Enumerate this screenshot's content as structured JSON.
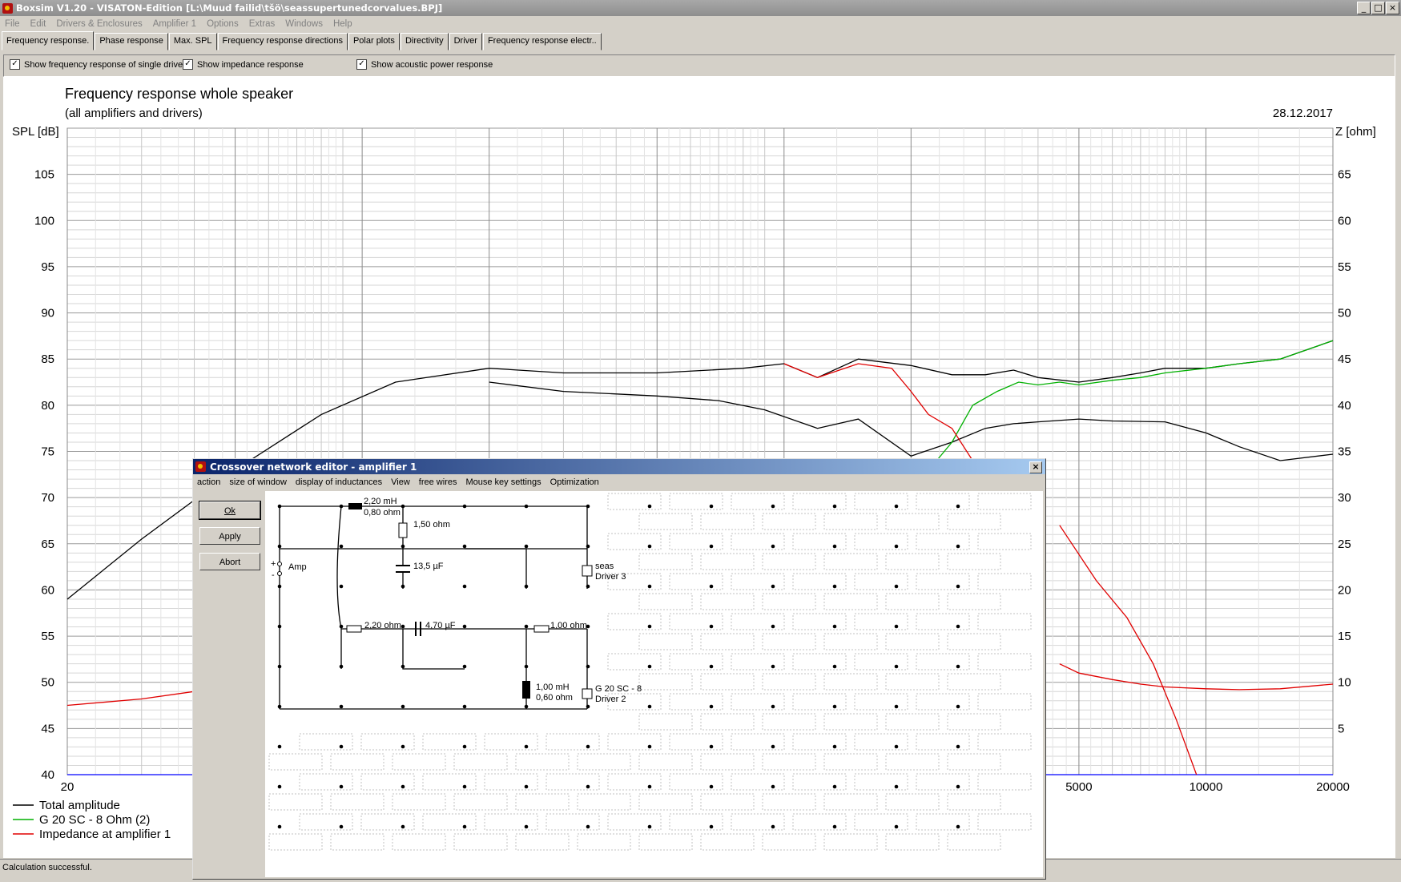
{
  "window": {
    "title": "Boxsim V1.20 - VISATON-Edition [L:\\Muud failid\\tšö\\seassupertunedcorvalues.BPJ]"
  },
  "menu": [
    "File",
    "Edit",
    "Drivers & Enclosures",
    "Amplifier 1",
    "Options",
    "Extras",
    "Windows",
    "Help"
  ],
  "tabs": [
    "Frequency response.",
    "Phase response",
    "Max. SPL",
    "Frequency response directions",
    "Polar plots",
    "Directivity",
    "Driver",
    "Frequency response electr.."
  ],
  "options": [
    {
      "label": "Show frequency response of single drive",
      "checked": true
    },
    {
      "label": "Show impedance response",
      "checked": true
    },
    {
      "label": "Show acoustic power response",
      "checked": true
    }
  ],
  "status": "Calculation successful.",
  "chart_data": {
    "type": "line",
    "title": "Frequency response whole speaker",
    "subtitle": "(all amplifiers and drivers)",
    "date": "28.12.2017",
    "ylabel": "SPL [dB]",
    "y2label": "Z [ohm]",
    "xscale": "log",
    "xlim": [
      20,
      20000
    ],
    "ylim": [
      40,
      110
    ],
    "y2lim": [
      0,
      70
    ],
    "xticks": [
      20,
      5000,
      10000,
      20000
    ],
    "yticks": [
      40,
      45,
      50,
      55,
      60,
      65,
      70,
      75,
      80,
      85,
      90,
      95,
      100,
      105
    ],
    "y2ticks": [
      5,
      10,
      15,
      20,
      25,
      30,
      35,
      40,
      45,
      50,
      55,
      60,
      65
    ],
    "legend_placement": "bottom-left",
    "series": [
      {
        "name": "Total amplitude",
        "color": "#000000",
        "x": [
          20,
          30,
          50,
          80,
          120,
          200,
          300,
          500,
          800,
          1000,
          1200,
          1500,
          2000,
          2500,
          3000,
          3500,
          4000,
          5000,
          6000,
          7000,
          8000,
          10000,
          12000,
          15000,
          20000
        ],
        "y": [
          59,
          65.5,
          73,
          79,
          82.5,
          84,
          83.5,
          83.5,
          84,
          84.5,
          83,
          85,
          84.3,
          83.3,
          83.3,
          83.8,
          83,
          82.5,
          83,
          83.5,
          84,
          84,
          84.5,
          85,
          87
        ]
      },
      {
        "name": "",
        "color": "#000000",
        "x": [
          200,
          300,
          500,
          700,
          900,
          1200,
          1500,
          2000,
          2500,
          3000,
          3500,
          4000,
          5000,
          6000,
          8000,
          10000,
          12000,
          15000,
          20000
        ],
        "y": [
          82.5,
          81.5,
          81,
          80.5,
          79.5,
          77.5,
          78.5,
          74.5,
          76,
          77.5,
          78,
          78.2,
          78.5,
          78.3,
          78.2,
          77,
          75.5,
          74,
          74.7
        ]
      },
      {
        "name": "G 20 SC - 8 Ohm (2)",
        "color": "#00b000",
        "x": [
          2300,
          2500,
          2800,
          3200,
          3600,
          4000,
          4500,
          5000,
          6000,
          7000,
          8000,
          10000,
          12000,
          15000,
          20000
        ],
        "y": [
          74,
          76,
          80,
          81.5,
          82.5,
          82.2,
          82.5,
          82.2,
          82.7,
          83,
          83.5,
          84,
          84.5,
          85,
          87
        ]
      },
      {
        "name": "",
        "color": "#e00000",
        "x": [
          1000,
          1200,
          1500,
          1800,
          2000,
          2200,
          2500,
          2800
        ],
        "y": [
          84.5,
          83,
          84.5,
          84,
          81.5,
          79,
          77.5,
          74
        ]
      },
      {
        "name": "Impedance at amplifier 1",
        "color": "#e00000",
        "x": [
          20,
          30,
          40,
          60
        ],
        "y": [
          7.5,
          8.2,
          9,
          11
        ]
      },
      {
        "name": "",
        "color": "#e00000",
        "x": [
          4500,
          5000,
          6000,
          7000,
          8000,
          10000,
          12000,
          15000,
          20000
        ],
        "y": [
          12,
          11,
          10.3,
          9.8,
          9.5,
          9.3,
          9.2,
          9.3,
          9.8
        ]
      },
      {
        "name": "",
        "color": "#e00000",
        "x": [
          4500,
          5500,
          6500,
          7500,
          8500,
          9500
        ],
        "y": [
          27,
          21,
          17,
          12,
          6,
          0
        ]
      }
    ]
  },
  "dialog": {
    "title": "Crossover network editor - amplifier 1",
    "menu": [
      "action",
      "size of window",
      "display of inductances",
      "View",
      "free wires",
      "Mouse key settings",
      "Optimization"
    ],
    "buttons": [
      "Ok",
      "Apply",
      "Abort"
    ],
    "components": {
      "amp": "Amp",
      "amp_plus": "+",
      "amp_minus": "-",
      "l1_val": "2,20 mH",
      "l1_res": "0,80 ohm",
      "r1": "1,50 ohm",
      "c1": "13,5 µF",
      "drv3_name": "seas",
      "drv3_label": "Driver 3",
      "r2": "2,20 ohm",
      "c2": "4,70 µF",
      "r3": "1,00 ohm",
      "l2_val": "1,00 mH",
      "l2_res": "0,60 ohm",
      "drv2_name": "G 20 SC - 8",
      "drv2_label": "Driver 2"
    }
  }
}
